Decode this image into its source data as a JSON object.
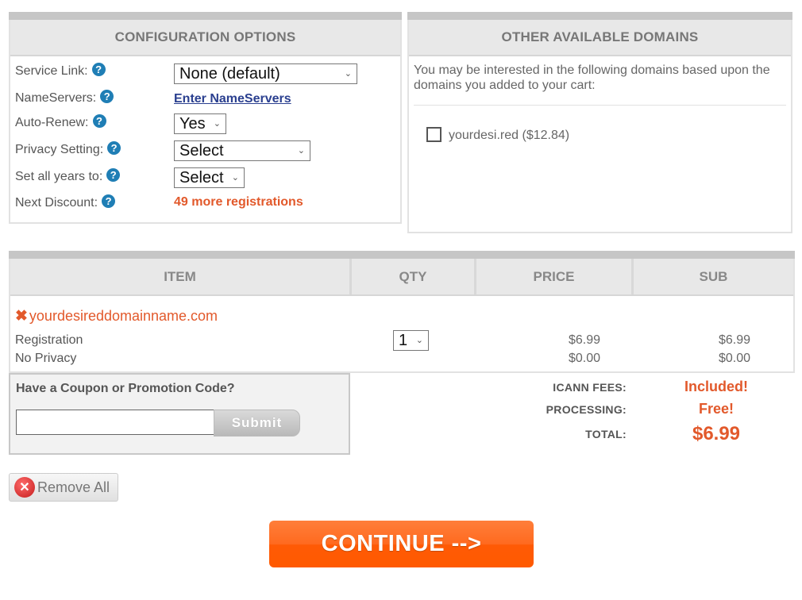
{
  "config": {
    "title": "CONFIGURATION OPTIONS",
    "rows": [
      {
        "label": "Service Link:",
        "type": "select",
        "value": "None (default)"
      },
      {
        "label": "NameServers:",
        "type": "link",
        "value": "Enter NameServers"
      },
      {
        "label": "Auto-Renew:",
        "type": "select",
        "value": "Yes"
      },
      {
        "label": "Privacy Setting:",
        "type": "select",
        "value": "Select"
      },
      {
        "label": "Set all years to:",
        "type": "select",
        "value": "Select"
      },
      {
        "label": "Next Discount:",
        "type": "text",
        "value": "49 more registrations"
      }
    ],
    "help_icon": "?"
  },
  "other": {
    "title": "OTHER AVAILABLE DOMAINS",
    "intro": "You may be interested in the following domains based upon the domains you added to your cart:",
    "domains": [
      {
        "label": "yourdesi.red ($12.84)",
        "checked": false
      }
    ]
  },
  "cart": {
    "columns": [
      "ITEM",
      "QTY",
      "PRICE",
      "SUB"
    ],
    "item": {
      "domain": "yourdesireddomainname.com",
      "remove_icon": "✖",
      "qty": "1",
      "lines": [
        {
          "label": "Registration",
          "price": "$6.99",
          "sub": "$6.99"
        },
        {
          "label": "No Privacy",
          "price": "$0.00",
          "sub": "$0.00"
        }
      ]
    }
  },
  "coupon": {
    "title": "Have a Coupon or Promotion Code?",
    "input_value": "",
    "submit_label": "Submit"
  },
  "summary": {
    "icann_label": "ICANN FEES:",
    "icann_value": "Included!",
    "processing_label": "PROCESSING:",
    "processing_value": "Free!",
    "total_label": "TOTAL:",
    "total_value": "$6.99"
  },
  "actions": {
    "remove_all_label": "Remove All",
    "remove_icon": "✕",
    "continue_label": "CONTINUE -->"
  },
  "colors": {
    "accent": "#e2592b",
    "link": "#2a3f8f",
    "help": "#1f7eb5",
    "continue": "#ff6a1f"
  }
}
